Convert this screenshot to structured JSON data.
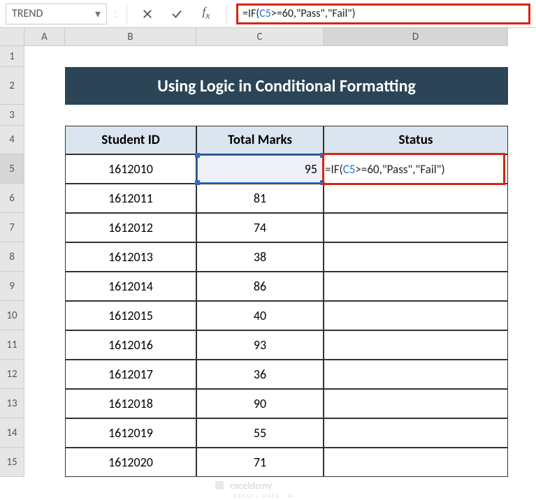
{
  "nameBox": "TREND",
  "formula": {
    "prefix": "=IF(",
    "ref": "C5",
    "suffix": ">=60,\"Pass\",\"Fail\")"
  },
  "title": "Using Logic in Conditional Formatting",
  "headers": {
    "studentId": "Student ID",
    "totalMarks": "Total Marks",
    "status": "Status"
  },
  "cols": [
    "A",
    "B",
    "C",
    "D"
  ],
  "rowNums": [
    "1",
    "2",
    "3",
    "4",
    "5",
    "6",
    "7",
    "8",
    "9",
    "10",
    "11",
    "12",
    "13",
    "14",
    "15"
  ],
  "data": [
    {
      "id": "1612010",
      "marks": "95"
    },
    {
      "id": "1612011",
      "marks": "81"
    },
    {
      "id": "1612012",
      "marks": "74"
    },
    {
      "id": "1612013",
      "marks": "38"
    },
    {
      "id": "1612014",
      "marks": "86"
    },
    {
      "id": "1612015",
      "marks": "40"
    },
    {
      "id": "1612016",
      "marks": "93"
    },
    {
      "id": "1612017",
      "marks": "36"
    },
    {
      "id": "1612018",
      "marks": "90"
    },
    {
      "id": "1612019",
      "marks": "55"
    },
    {
      "id": "1612020",
      "marks": "71"
    }
  ],
  "editCell": {
    "prefix": "=IF(",
    "ref": "C5",
    "suffix": ">=60,\"Pass\",\"Fail\")"
  },
  "watermark": "exceldemy",
  "watermarkSub": "EXCEL · DATA · BI"
}
